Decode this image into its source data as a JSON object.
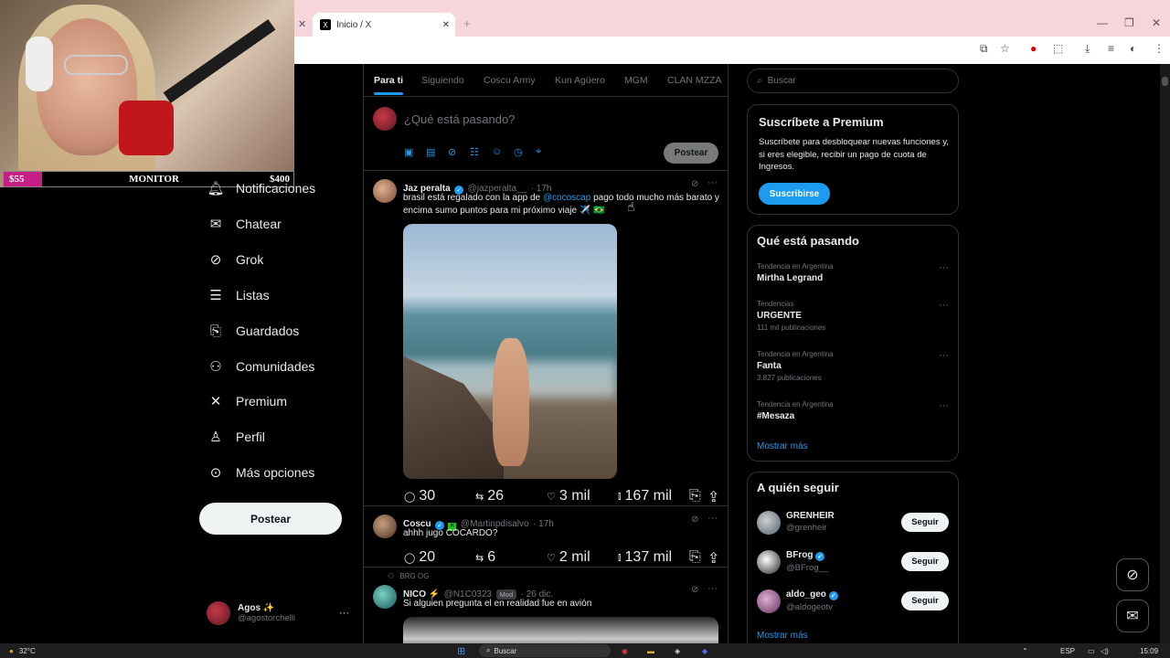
{
  "overlay": {
    "monitor_low": "$55",
    "monitor_label": "MONITOR",
    "monitor_high": "$400"
  },
  "browser": {
    "tab1_title": "Inicio / X",
    "new_tab": "+"
  },
  "nav": {
    "items": [
      {
        "label": "Notificaciones",
        "icon": "bell-icon"
      },
      {
        "label": "Chatear",
        "icon": "mail-icon"
      },
      {
        "label": "Grok",
        "icon": "grok-icon"
      },
      {
        "label": "Listas",
        "icon": "list-icon"
      },
      {
        "label": "Guardados",
        "icon": "bookmark-icon"
      },
      {
        "label": "Comunidades",
        "icon": "communities-icon"
      },
      {
        "label": "Premium",
        "icon": "x-icon"
      },
      {
        "label": "Perfil",
        "icon": "person-icon"
      },
      {
        "label": "Más opciones",
        "icon": "more-icon"
      }
    ],
    "post_button": "Postear",
    "account_name": "Agos ✨",
    "account_handle": "@agostorchelli",
    "account_more": "···"
  },
  "feed": {
    "tabs": [
      "Para ti",
      "Siguiendo",
      "Coscu Army",
      "Kun Agüero",
      "MGM",
      "CLAN MZZA"
    ],
    "compose_placeholder": "¿Qué está pasando?",
    "compose_button": "Postear",
    "tweets": [
      {
        "name": "Jaz peralta",
        "handle": "@jazperalta__",
        "time": "· 17h",
        "text_before": "brasil está regalado con la app de ",
        "mention": "@cocoscap",
        "text_after": " pago todo mucho más barato y encima sumo puntos para mi próximo viaje ✈️ 🇧🇷",
        "replies": "30",
        "retweets": "26",
        "likes": "3 mil",
        "views": "167 mil"
      },
      {
        "name": "Coscu",
        "handle": "@Martinpdisalvo",
        "time": "· 17h",
        "text": "ahhh jugo COCARDO?",
        "replies": "20",
        "retweets": "6",
        "likes": "2 mil",
        "views": "137 mil"
      },
      {
        "context": "BRG OG",
        "name": "NICO ⚡",
        "handle": "@N1C0323",
        "badge": "Mod",
        "time": "· 26 dic.",
        "text": "Si alguien pregunta el en realidad fue en avión"
      }
    ]
  },
  "right": {
    "search_placeholder": "Buscar",
    "premium": {
      "title": "Suscríbete a Premium",
      "text": "Suscríbete para desbloquear nuevas funciones y, si eres elegible, recibir un pago de cuota de Ingresos.",
      "button": "Suscribirse"
    },
    "trends": {
      "title": "Qué está pasando",
      "items": [
        {
          "meta": "Tendencia en Argentina",
          "title": "Mirtha Legrand",
          "count": ""
        },
        {
          "meta": "Tendencias",
          "title": "URGENTE",
          "count": "111 mil publicaciones"
        },
        {
          "meta": "Tendencia en Argentina",
          "title": "Fanta",
          "count": "3.827 publicaciones"
        },
        {
          "meta": "Tendencia en Argentina",
          "title": "#Mesaza",
          "count": ""
        }
      ],
      "more": "Mostrar más"
    },
    "who": {
      "title": "A quién seguir",
      "items": [
        {
          "name": "GRENHEIR",
          "handle": "@grenheir",
          "button": "Seguir"
        },
        {
          "name": "BFrog",
          "handle": "@BFrog__",
          "button": "Seguir"
        },
        {
          "name": "aldo_geo",
          "handle": "@aldogeotv",
          "button": "Seguir"
        }
      ],
      "more": "Mostrar más"
    }
  },
  "taskbar": {
    "temp": "32°C",
    "search": "Buscar",
    "lang": "ESP",
    "time": "15:09"
  }
}
